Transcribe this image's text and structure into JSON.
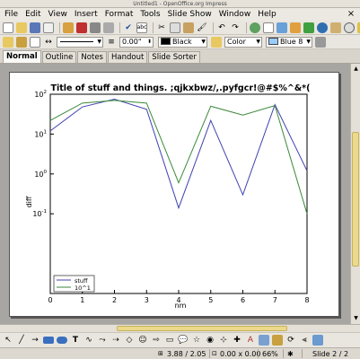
{
  "window": {
    "title": "Untitled1 - OpenOffice.org Impress"
  },
  "menu": {
    "items": [
      "File",
      "Edit",
      "View",
      "Insert",
      "Format",
      "Tools",
      "Slide Show",
      "Window",
      "Help"
    ],
    "close": "×"
  },
  "toolbar2": {
    "line_width": "0.00\"",
    "line_color": "Black",
    "area_style": "Color",
    "area_color": "Blue 8",
    "colors": {
      "line": "#000000",
      "area": "#99ccff"
    }
  },
  "tabs": [
    "Normal",
    "Outline",
    "Notes",
    "Handout",
    "Slide Sorter"
  ],
  "chart_data": {
    "type": "line",
    "title": "Title of stuff and things. ;qjkxbwz/,.pyfgcr!@#$%^&*(",
    "xlabel": "nm",
    "ylabel": "diff",
    "x": [
      0,
      1,
      2,
      3,
      4,
      5,
      6,
      7,
      8
    ],
    "xlim": [
      0,
      8
    ],
    "ylim": [
      0.001,
      100
    ],
    "yscale": "log",
    "xticks": [
      "0",
      "1",
      "2",
      "3",
      "4",
      "5",
      "6",
      "7",
      "8"
    ],
    "yticks": [
      {
        "base": "10",
        "exp": "2",
        "value": 100
      },
      {
        "base": "10",
        "exp": "1",
        "value": 10
      },
      {
        "base": "10",
        "exp": "0",
        "value": 1
      },
      {
        "base": "10",
        "exp": "-1",
        "value": 0.1
      }
    ],
    "legend_position": "lower-left",
    "series": [
      {
        "name": "stuff",
        "color": "#4040b0",
        "values": [
          12,
          48,
          75,
          42,
          0.14,
          22,
          0.3,
          55,
          1.2
        ]
      },
      {
        "name": "10^1",
        "color": "#3a8a3a",
        "values": [
          22,
          60,
          70,
          60,
          0.6,
          50,
          30,
          52,
          0.1
        ]
      }
    ]
  },
  "status": {
    "position": "3.88 / 2.05",
    "size": "0.00 x 0.00",
    "zoom": "66%",
    "slide": "Slide 2 / 2"
  }
}
